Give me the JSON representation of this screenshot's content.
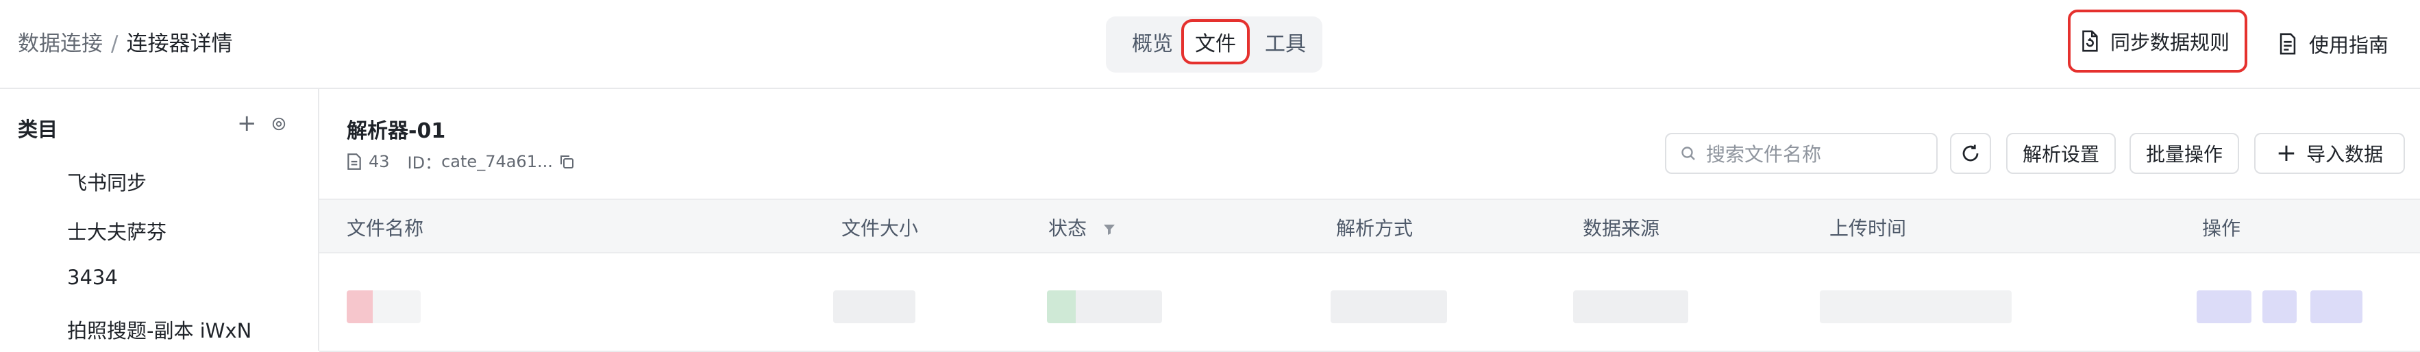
{
  "header": {
    "breadcrumb": {
      "parent": "数据连接",
      "separator": "/",
      "current": "连接器详情"
    },
    "tabs": [
      {
        "label": "概览",
        "active": false
      },
      {
        "label": "文件",
        "active": true
      },
      {
        "label": "工具",
        "active": false
      }
    ],
    "sync_rules_label": "同步数据规则",
    "guide_label": "使用指南"
  },
  "sidebar": {
    "title": "类目",
    "add_symbol": "+",
    "items": [
      {
        "label": "飞书同步"
      },
      {
        "label": "士大夫萨芬"
      },
      {
        "label": "3434"
      },
      {
        "label": "拍照搜题-副本 iWxN"
      }
    ]
  },
  "main": {
    "parser_name": "解析器-01",
    "file_count": "43",
    "id_label": "ID：",
    "id_value": "cate_74a61...",
    "search": {
      "placeholder": "搜索文件名称"
    },
    "toolbar": {
      "parse_settings": "解析设置",
      "batch_ops": "批量操作",
      "import_data": "导入数据",
      "import_symbol": "+"
    },
    "table": {
      "columns": [
        "文件名称",
        "文件大小",
        "状态",
        "解析方式",
        "数据来源",
        "上传时间",
        "操作"
      ]
    }
  },
  "colors": {
    "highlight_border": "#e5312e",
    "header_bg": "#f5f6f7",
    "text_primary": "#1f2329",
    "text_secondary": "#646a73"
  },
  "icons": [
    "file-sync-icon",
    "document-icon",
    "settings-icon",
    "copy-icon",
    "search-icon",
    "refresh-icon",
    "filter-icon",
    "plus-icon"
  ]
}
